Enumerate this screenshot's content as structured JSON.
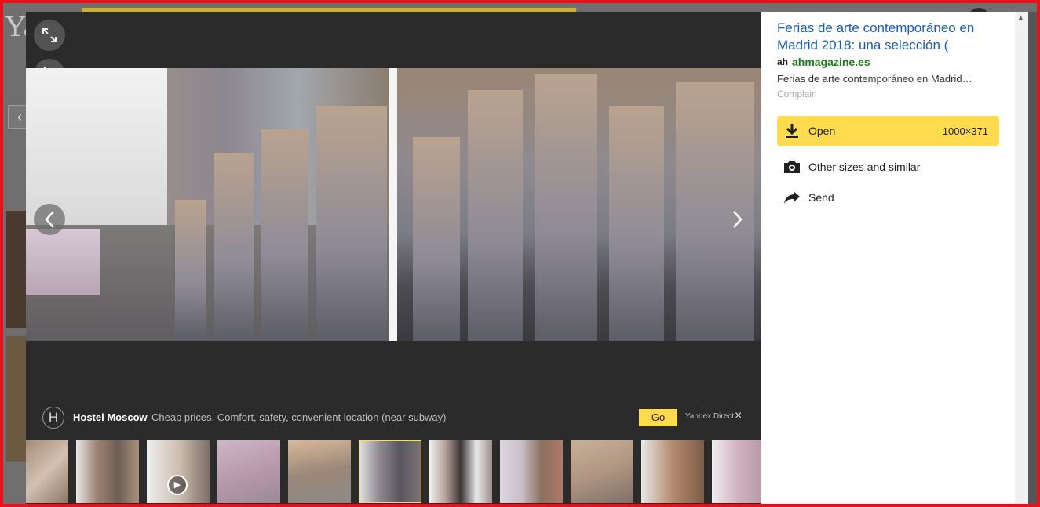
{
  "background": {
    "logo_text": "Ya",
    "back_icon": "chevron-left-icon"
  },
  "viewer": {
    "expand_icon": "expand-icon",
    "crop_icon": "crop-icon",
    "prev_icon": "chevron-left-icon",
    "next_icon": "chevron-right-icon"
  },
  "ad": {
    "letter": "H",
    "title": "Hostel Moscow",
    "text": "Cheap prices. Comfort, safety, convenient location (near subway)",
    "go_label": "Go",
    "source": "Yandex.Direct",
    "close": "×"
  },
  "thumbnails": [
    {
      "selected": false,
      "video": false
    },
    {
      "selected": false,
      "video": false
    },
    {
      "selected": false,
      "video": true
    },
    {
      "selected": false,
      "video": false
    },
    {
      "selected": false,
      "video": false
    },
    {
      "selected": true,
      "video": false
    },
    {
      "selected": false,
      "video": false
    },
    {
      "selected": false,
      "video": false
    },
    {
      "selected": false,
      "video": false
    },
    {
      "selected": false,
      "video": false
    },
    {
      "selected": false,
      "video": false
    }
  ],
  "info": {
    "title": "Ferias de arte contemporáneo en Madrid 2018: una selección (",
    "source_logo": "ah",
    "source_domain": "ahmagazine.es",
    "description": "Ferias de arte contemporáneo en Madrid…",
    "complain": "Complain",
    "open_label": "Open",
    "open_size": "1000×371",
    "other_sizes_label": "Other sizes and similar",
    "send_label": "Send"
  },
  "colors": {
    "accent": "#ffdb4d",
    "link": "#1a5db6",
    "domain": "#1b7e1b",
    "viewer_bg": "#2b2b2b",
    "frame": "#e8101a"
  }
}
